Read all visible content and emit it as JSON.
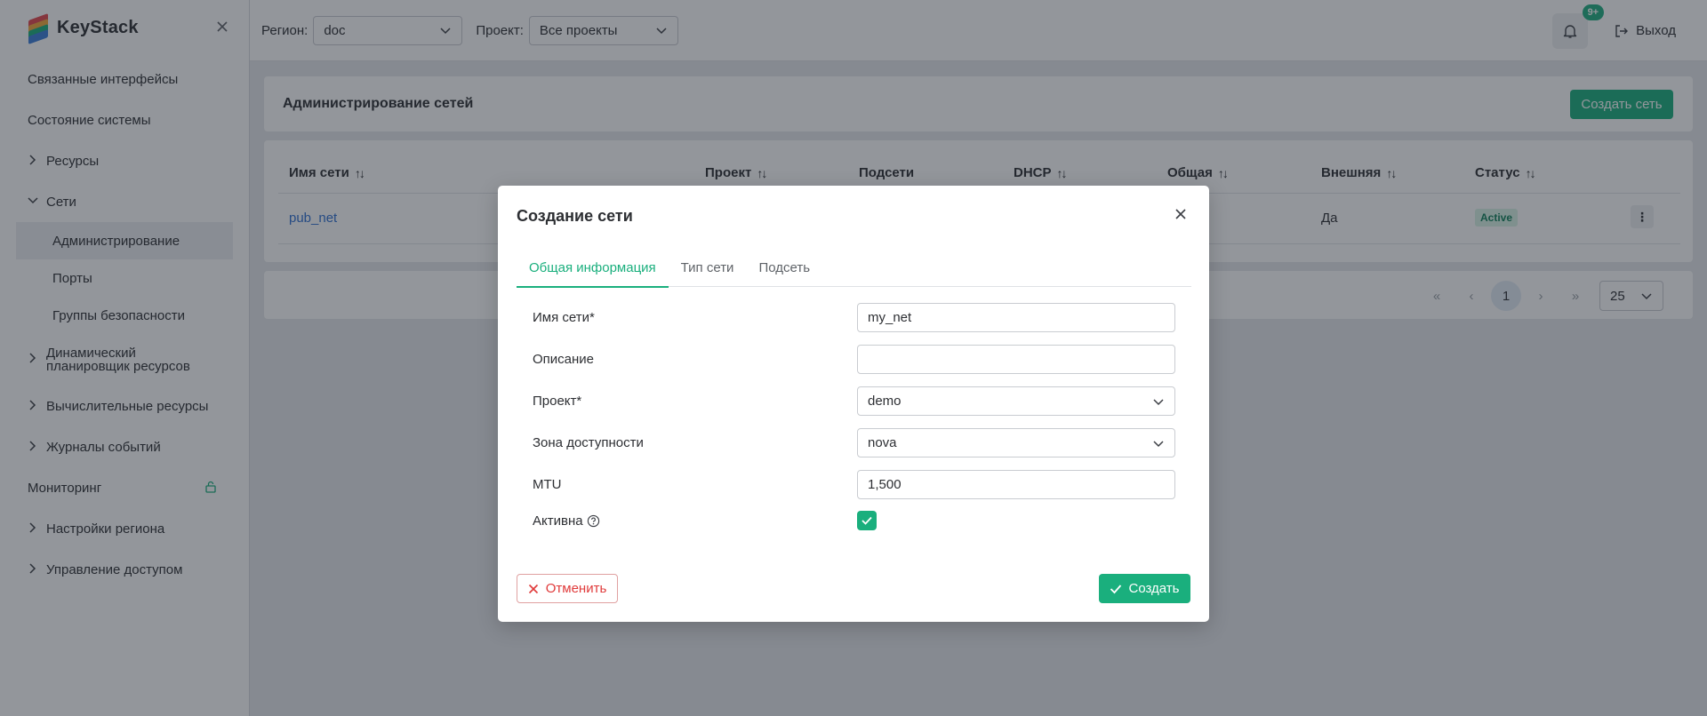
{
  "app": {
    "name": "KeyStack"
  },
  "sidebar": {
    "items": [
      {
        "label": "Связанные интерфейсы"
      },
      {
        "label": "Состояние системы"
      },
      {
        "label": "Ресурсы"
      },
      {
        "label": "Сети"
      },
      {
        "label": "Администрирование"
      },
      {
        "label": "Порты"
      },
      {
        "label": "Группы безопасности"
      },
      {
        "label_line1": "Динамический",
        "label_line2": "планировщик ресурсов"
      },
      {
        "label": "Вычислительные ресурсы"
      },
      {
        "label": "Журналы событий"
      },
      {
        "label": "Мониторинг"
      },
      {
        "label": "Настройки региона"
      },
      {
        "label": "Управление доступом"
      }
    ]
  },
  "topbar": {
    "region_label": "Регион:",
    "region_value": "doc",
    "project_label": "Проект:",
    "project_value": "Все проекты",
    "notifications_badge": "9+",
    "logout_label": "Выход"
  },
  "page": {
    "title": "Администрирование сетей",
    "create_button": "Создать сеть"
  },
  "table": {
    "columns": [
      "Имя сети",
      "Проект",
      "Подсети",
      "DHCP",
      "Общая",
      "Внешняя",
      "Статус"
    ],
    "rows": [
      {
        "name": "pub_net",
        "external": "Да",
        "status": "Active"
      }
    ]
  },
  "pagination": {
    "current": "1",
    "page_size": "25"
  },
  "modal": {
    "title": "Создание сети",
    "tabs": [
      "Общая информация",
      "Тип сети",
      "Подсеть"
    ],
    "fields": {
      "name_label": "Имя сети*",
      "name_value": "my_net",
      "description_label": "Описание",
      "description_value": "",
      "project_label": "Проект*",
      "project_value": "demo",
      "zone_label": "Зона доступности",
      "zone_value": "nova",
      "mtu_label": "MTU",
      "mtu_value": "1,500",
      "active_label": "Активна",
      "active_checked": true
    },
    "cancel_label": "Отменить",
    "create_label": "Создать"
  },
  "colors": {
    "accent": "#1aaf7d",
    "danger": "#e03a3a",
    "link": "#2f6fd1"
  }
}
